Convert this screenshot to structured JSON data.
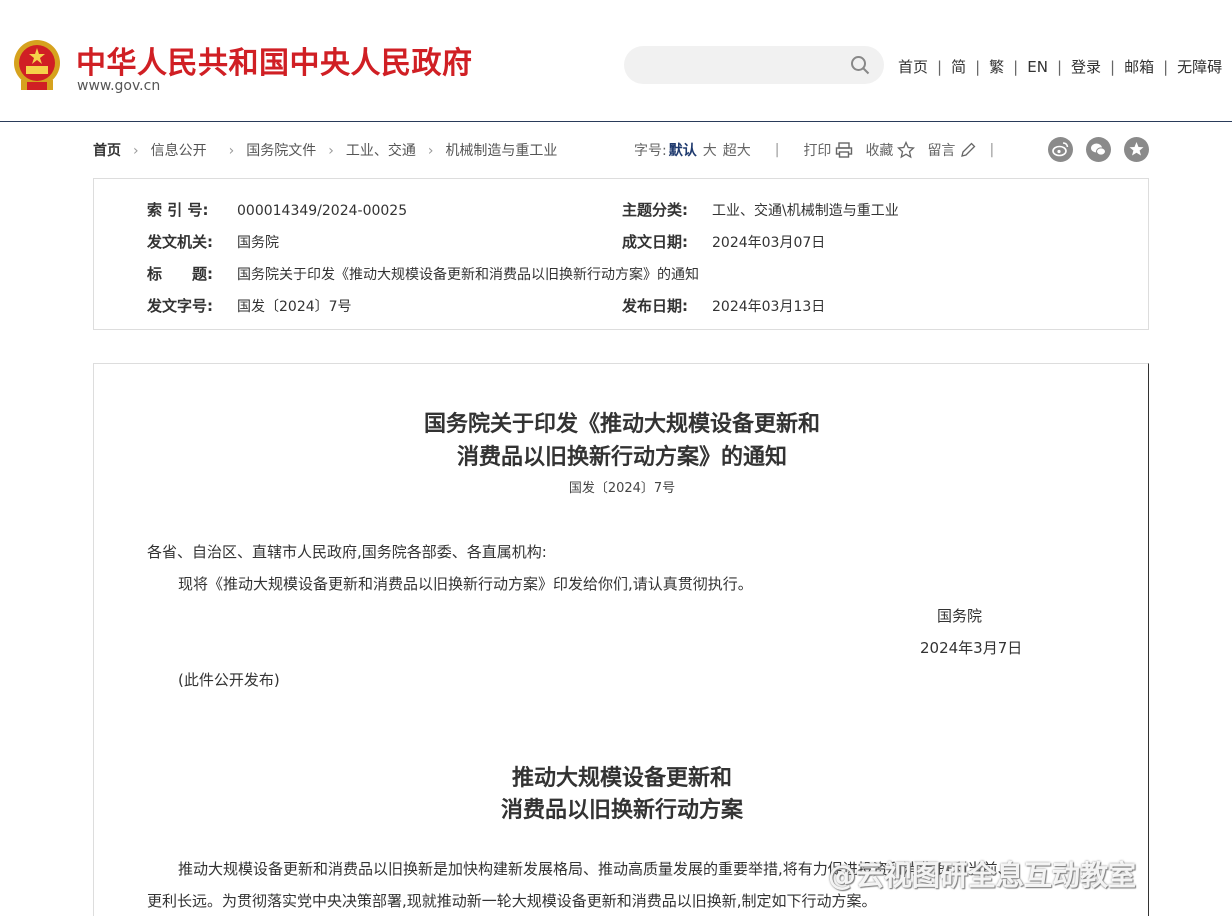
{
  "header": {
    "site_title": "中华人民共和国中央人民政府",
    "site_url": "www.gov.cn",
    "search_placeholder": "",
    "nav": [
      "首页",
      "简",
      "繁",
      "EN",
      "登录",
      "邮箱",
      "无障碍"
    ]
  },
  "breadcrumb": [
    "首页",
    "信息公开",
    "国务院文件",
    "工业、交通",
    "机械制造与重工业"
  ],
  "toolbar": {
    "font_size_label": "字号:",
    "font_default": "默认",
    "font_large": "大",
    "font_xlarge": "超大",
    "print": "打印",
    "favorite": "收藏",
    "comment": "留言"
  },
  "meta": {
    "index_no_label": "索 引 号:",
    "index_no": "000014349/2024-00025",
    "category_label": "主题分类:",
    "category": "工业、交通\\机械制造与重工业",
    "issuer_label": "发文机关:",
    "issuer": "国务院",
    "created_label": "成文日期:",
    "created": "2024年03月07日",
    "title_label": "标　　题:",
    "title": "国务院关于印发《推动大规模设备更新和消费品以旧换新行动方案》的通知",
    "doc_no_label": "发文字号:",
    "doc_no": "国发〔2024〕7号",
    "published_label": "发布日期:",
    "published": "2024年03月13日"
  },
  "article": {
    "title_line1": "国务院关于印发《推动大规模设备更新和",
    "title_line2": "消费品以旧换新行动方案》的通知",
    "doc_no": "国发〔2024〕7号",
    "addressee": "各省、自治区、直辖市人民政府,国务院各部委、各直属机构:",
    "body": "现将《推动大规模设备更新和消费品以旧换新行动方案》印发给你们,请认真贯彻执行。",
    "signer": "国务院",
    "sign_date": "2024年3月7日",
    "public_note": "(此件公开发布)",
    "plan_title_line1": "推动大规模设备更新和",
    "plan_title_line2": "消费品以旧换新行动方案",
    "plan_para1": "推动大规模设备更新和消费品以旧换新是加快构建新发展格局、推动高质量发展的重要举措,将有力促进投资和消费,既利当前、",
    "plan_para2": "更利长远。为贯彻落实党中央决策部署,现就推动新一轮大规模设备更新和消费品以旧换新,制定如下行动方案。"
  },
  "watermark": "@云视图研全息互动教室",
  "colors": {
    "brand_red": "#d01f24",
    "header_rule": "#2a3b5a",
    "font_default": "#1f3a6e"
  }
}
